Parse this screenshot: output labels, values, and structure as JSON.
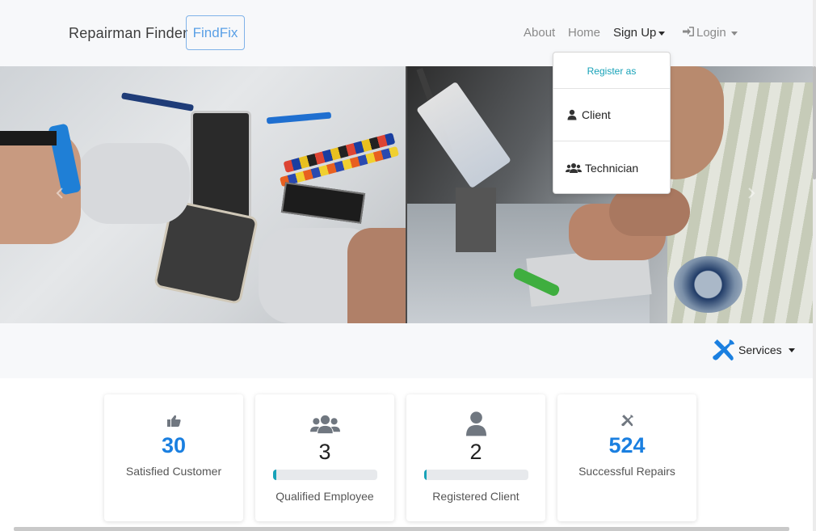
{
  "navbar": {
    "brand": "Repairman Finder",
    "badge": "FindFix",
    "links": {
      "about": "About",
      "home": "Home",
      "signup": "Sign Up",
      "login": "Login"
    },
    "icons": {
      "login": "sign-in-icon",
      "caret": "caret-down-icon"
    }
  },
  "signup_dropdown": {
    "header": "Register as",
    "items": [
      {
        "label": "Client",
        "icon": "user-icon"
      },
      {
        "label": "Technician",
        "icon": "users-icon"
      }
    ]
  },
  "hero": {
    "left_image": "phone repair photo",
    "right_image": "soldering repair photo"
  },
  "services": {
    "label": "Services",
    "icon": "tools-icon"
  },
  "stats": [
    {
      "value": "30",
      "label": "Satisfied Customer",
      "icon": "thumbs-up-icon"
    },
    {
      "value": "3",
      "label": "Qualified Employee",
      "icon": "users-icon",
      "progress": 0.03
    },
    {
      "value": "2",
      "label": "Registered Client",
      "icon": "user-icon",
      "progress": 0.02
    },
    {
      "value": "524",
      "label": "Successful Repairs",
      "icon": "tools-icon"
    }
  ],
  "colors": {
    "accent_blue": "#1a7fe0",
    "info_teal": "#17a2b8",
    "navbar_bg": "#f7f8fa"
  }
}
